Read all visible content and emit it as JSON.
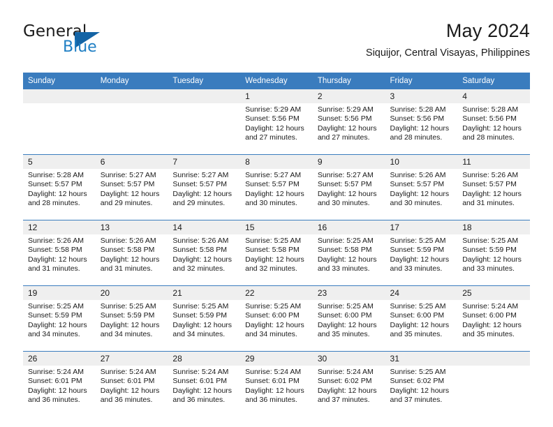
{
  "brand": {
    "word_one": "General",
    "word_two": "Blue",
    "triangle_color": "#1464a5",
    "blue_text_color": "#1f7fc4"
  },
  "header": {
    "title": "May 2024",
    "subtitle": "Siquijor, Central Visayas, Philippines"
  },
  "theme": {
    "header_bg": "#3a7cbe",
    "daynum_bg": "#efefef",
    "rule_color": "#3a7cbe",
    "text_color": "#1a1a1a"
  },
  "calendar": {
    "weekday_headers": [
      "Sunday",
      "Monday",
      "Tuesday",
      "Wednesday",
      "Thursday",
      "Friday",
      "Saturday"
    ],
    "weeks": [
      {
        "numbers": [
          "",
          "",
          "",
          "1",
          "2",
          "3",
          "4"
        ],
        "cells": [
          {
            "empty": true,
            "sunrise": "",
            "sunset": "",
            "daylight": ""
          },
          {
            "empty": true,
            "sunrise": "",
            "sunset": "",
            "daylight": ""
          },
          {
            "empty": true,
            "sunrise": "",
            "sunset": "",
            "daylight": ""
          },
          {
            "empty": false,
            "sunrise": "Sunrise: 5:29 AM",
            "sunset": "Sunset: 5:56 PM",
            "daylight": "Daylight: 12 hours and 27 minutes."
          },
          {
            "empty": false,
            "sunrise": "Sunrise: 5:29 AM",
            "sunset": "Sunset: 5:56 PM",
            "daylight": "Daylight: 12 hours and 27 minutes."
          },
          {
            "empty": false,
            "sunrise": "Sunrise: 5:28 AM",
            "sunset": "Sunset: 5:56 PM",
            "daylight": "Daylight: 12 hours and 28 minutes."
          },
          {
            "empty": false,
            "sunrise": "Sunrise: 5:28 AM",
            "sunset": "Sunset: 5:56 PM",
            "daylight": "Daylight: 12 hours and 28 minutes."
          }
        ]
      },
      {
        "numbers": [
          "5",
          "6",
          "7",
          "8",
          "9",
          "10",
          "11"
        ],
        "cells": [
          {
            "empty": false,
            "sunrise": "Sunrise: 5:28 AM",
            "sunset": "Sunset: 5:57 PM",
            "daylight": "Daylight: 12 hours and 28 minutes."
          },
          {
            "empty": false,
            "sunrise": "Sunrise: 5:27 AM",
            "sunset": "Sunset: 5:57 PM",
            "daylight": "Daylight: 12 hours and 29 minutes."
          },
          {
            "empty": false,
            "sunrise": "Sunrise: 5:27 AM",
            "sunset": "Sunset: 5:57 PM",
            "daylight": "Daylight: 12 hours and 29 minutes."
          },
          {
            "empty": false,
            "sunrise": "Sunrise: 5:27 AM",
            "sunset": "Sunset: 5:57 PM",
            "daylight": "Daylight: 12 hours and 30 minutes."
          },
          {
            "empty": false,
            "sunrise": "Sunrise: 5:27 AM",
            "sunset": "Sunset: 5:57 PM",
            "daylight": "Daylight: 12 hours and 30 minutes."
          },
          {
            "empty": false,
            "sunrise": "Sunrise: 5:26 AM",
            "sunset": "Sunset: 5:57 PM",
            "daylight": "Daylight: 12 hours and 30 minutes."
          },
          {
            "empty": false,
            "sunrise": "Sunrise: 5:26 AM",
            "sunset": "Sunset: 5:57 PM",
            "daylight": "Daylight: 12 hours and 31 minutes."
          }
        ]
      },
      {
        "numbers": [
          "12",
          "13",
          "14",
          "15",
          "16",
          "17",
          "18"
        ],
        "cells": [
          {
            "empty": false,
            "sunrise": "Sunrise: 5:26 AM",
            "sunset": "Sunset: 5:58 PM",
            "daylight": "Daylight: 12 hours and 31 minutes."
          },
          {
            "empty": false,
            "sunrise": "Sunrise: 5:26 AM",
            "sunset": "Sunset: 5:58 PM",
            "daylight": "Daylight: 12 hours and 31 minutes."
          },
          {
            "empty": false,
            "sunrise": "Sunrise: 5:26 AM",
            "sunset": "Sunset: 5:58 PM",
            "daylight": "Daylight: 12 hours and 32 minutes."
          },
          {
            "empty": false,
            "sunrise": "Sunrise: 5:25 AM",
            "sunset": "Sunset: 5:58 PM",
            "daylight": "Daylight: 12 hours and 32 minutes."
          },
          {
            "empty": false,
            "sunrise": "Sunrise: 5:25 AM",
            "sunset": "Sunset: 5:58 PM",
            "daylight": "Daylight: 12 hours and 33 minutes."
          },
          {
            "empty": false,
            "sunrise": "Sunrise: 5:25 AM",
            "sunset": "Sunset: 5:59 PM",
            "daylight": "Daylight: 12 hours and 33 minutes."
          },
          {
            "empty": false,
            "sunrise": "Sunrise: 5:25 AM",
            "sunset": "Sunset: 5:59 PM",
            "daylight": "Daylight: 12 hours and 33 minutes."
          }
        ]
      },
      {
        "numbers": [
          "19",
          "20",
          "21",
          "22",
          "23",
          "24",
          "25"
        ],
        "cells": [
          {
            "empty": false,
            "sunrise": "Sunrise: 5:25 AM",
            "sunset": "Sunset: 5:59 PM",
            "daylight": "Daylight: 12 hours and 34 minutes."
          },
          {
            "empty": false,
            "sunrise": "Sunrise: 5:25 AM",
            "sunset": "Sunset: 5:59 PM",
            "daylight": "Daylight: 12 hours and 34 minutes."
          },
          {
            "empty": false,
            "sunrise": "Sunrise: 5:25 AM",
            "sunset": "Sunset: 5:59 PM",
            "daylight": "Daylight: 12 hours and 34 minutes."
          },
          {
            "empty": false,
            "sunrise": "Sunrise: 5:25 AM",
            "sunset": "Sunset: 6:00 PM",
            "daylight": "Daylight: 12 hours and 34 minutes."
          },
          {
            "empty": false,
            "sunrise": "Sunrise: 5:25 AM",
            "sunset": "Sunset: 6:00 PM",
            "daylight": "Daylight: 12 hours and 35 minutes."
          },
          {
            "empty": false,
            "sunrise": "Sunrise: 5:25 AM",
            "sunset": "Sunset: 6:00 PM",
            "daylight": "Daylight: 12 hours and 35 minutes."
          },
          {
            "empty": false,
            "sunrise": "Sunrise: 5:24 AM",
            "sunset": "Sunset: 6:00 PM",
            "daylight": "Daylight: 12 hours and 35 minutes."
          }
        ]
      },
      {
        "numbers": [
          "26",
          "27",
          "28",
          "29",
          "30",
          "31",
          ""
        ],
        "cells": [
          {
            "empty": false,
            "sunrise": "Sunrise: 5:24 AM",
            "sunset": "Sunset: 6:01 PM",
            "daylight": "Daylight: 12 hours and 36 minutes."
          },
          {
            "empty": false,
            "sunrise": "Sunrise: 5:24 AM",
            "sunset": "Sunset: 6:01 PM",
            "daylight": "Daylight: 12 hours and 36 minutes."
          },
          {
            "empty": false,
            "sunrise": "Sunrise: 5:24 AM",
            "sunset": "Sunset: 6:01 PM",
            "daylight": "Daylight: 12 hours and 36 minutes."
          },
          {
            "empty": false,
            "sunrise": "Sunrise: 5:24 AM",
            "sunset": "Sunset: 6:01 PM",
            "daylight": "Daylight: 12 hours and 36 minutes."
          },
          {
            "empty": false,
            "sunrise": "Sunrise: 5:24 AM",
            "sunset": "Sunset: 6:02 PM",
            "daylight": "Daylight: 12 hours and 37 minutes."
          },
          {
            "empty": false,
            "sunrise": "Sunrise: 5:25 AM",
            "sunset": "Sunset: 6:02 PM",
            "daylight": "Daylight: 12 hours and 37 minutes."
          },
          {
            "empty": true,
            "sunrise": "",
            "sunset": "",
            "daylight": ""
          }
        ]
      }
    ]
  }
}
